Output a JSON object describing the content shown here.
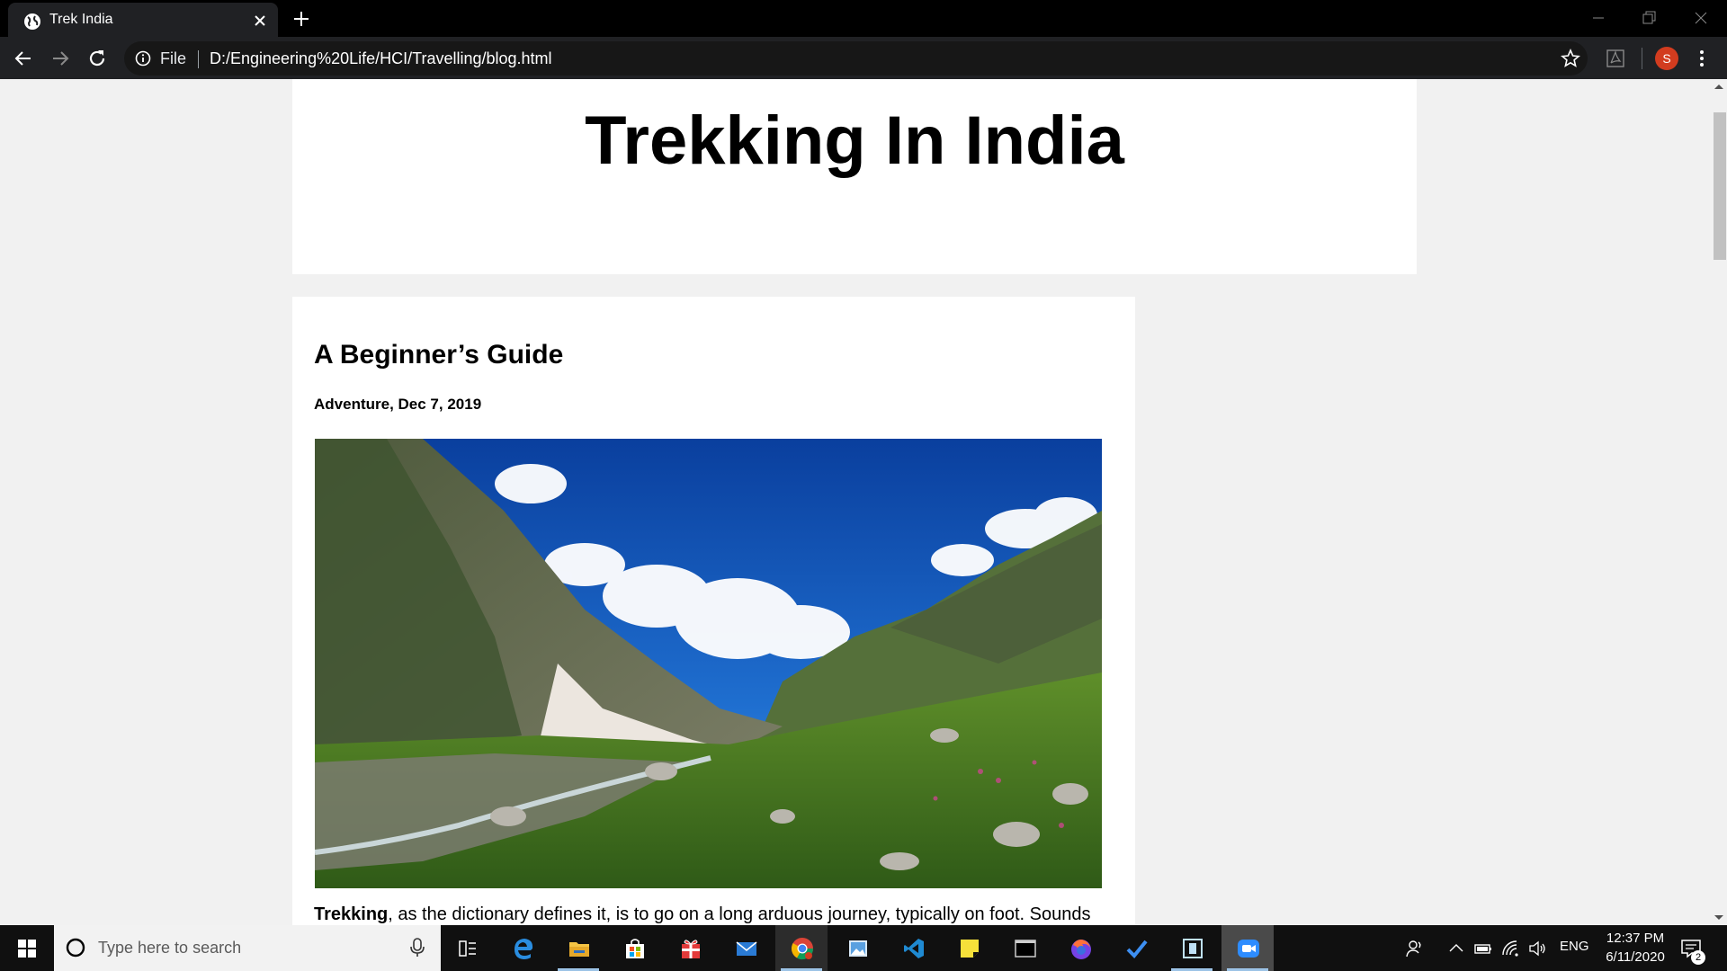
{
  "browser": {
    "tab_title": "Trek India",
    "scheme_label": "File",
    "url": "D:/Engineering%20Life/HCI/Travelling/blog.html",
    "profile_initial": "S"
  },
  "page": {
    "site_title": "Trekking In India",
    "post": {
      "title": "A Beginner’s Guide",
      "meta": "Adventure, Dec 7, 2019",
      "image_alt": "Himalayan valley with glacier, green meadow and blue sky",
      "excerpt_bold": "Trekking",
      "excerpt_rest": ", as the dictionary defines it, is to go on a long arduous journey, typically on foot. Sounds"
    }
  },
  "taskbar": {
    "search_placeholder": "Type here to search",
    "apps": [
      "Task View",
      "Microsoft Edge",
      "File Explorer",
      "Microsoft Store",
      "Gift",
      "Mail",
      "Google Chrome",
      "Photos",
      "Visual Studio Code",
      "Sticky Notes",
      "Terminal",
      "Firefox",
      "Microsoft To Do",
      "Snipping",
      "Zoom"
    ],
    "language": "ENG",
    "time": "12:37 PM",
    "date": "6/11/2020",
    "notification_count": "2"
  },
  "colors": {
    "chrome_dark": "#202124",
    "page_bg": "#f1f1f1",
    "avatar": "#d23c1f",
    "zoom_blue": "#2d8cff"
  }
}
